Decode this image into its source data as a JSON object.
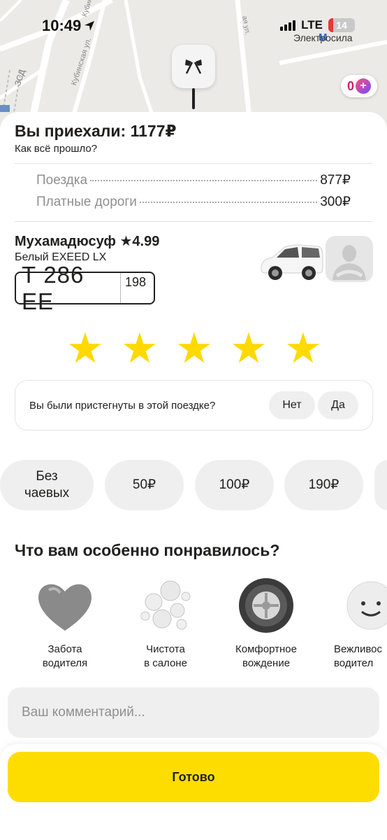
{
  "status_bar": {
    "time": "10:49",
    "network": "LTE",
    "battery": "14"
  },
  "map": {
    "streets": [
      "Кубинская ул.",
      "Кубинс",
      "ЗСД",
      "ая ул."
    ],
    "metro_station": "Электросила",
    "plus_points": "0"
  },
  "trip": {
    "title": "Вы приехали: 1177₽",
    "subtitle": "Как всё прошло?",
    "lines": [
      {
        "label": "Поездка",
        "value": "877₽"
      },
      {
        "label": "Платные дороги",
        "value": "300₽"
      }
    ]
  },
  "driver": {
    "name": "Мухамадюсуф ★4.99",
    "car": "Белый EXEED LX",
    "plate_main": "Т 286 ЕЕ",
    "plate_region": "198",
    "car_color": "#ffffff"
  },
  "rating": {
    "stars_filled": 5,
    "stars_total": 5,
    "star_symbol": "★",
    "star_color": "#ffd900"
  },
  "seatbelt": {
    "question": "Вы были пристегнуты в этой поездке?",
    "no_label": "Нет",
    "yes_label": "Да"
  },
  "tips": [
    {
      "label": "Без\nчаевых"
    },
    {
      "label": "50₽"
    },
    {
      "label": "100₽"
    },
    {
      "label": "190₽"
    }
  ],
  "liked": {
    "title": "Что вам особенно понравилось?",
    "items": [
      {
        "label": "Забота\nводителя",
        "icon": "heart-icon"
      },
      {
        "label": "Чистота\nв салоне",
        "icon": "bubbles-icon"
      },
      {
        "label": "Комфортное\nвождение",
        "icon": "wheel-icon"
      },
      {
        "label": "Вежливос\nводител",
        "icon": "smile-icon"
      }
    ]
  },
  "comment": {
    "placeholder": "Ваш комментарий..."
  },
  "footer": {
    "done_label": "Готово",
    "accent": "#fddd00"
  }
}
